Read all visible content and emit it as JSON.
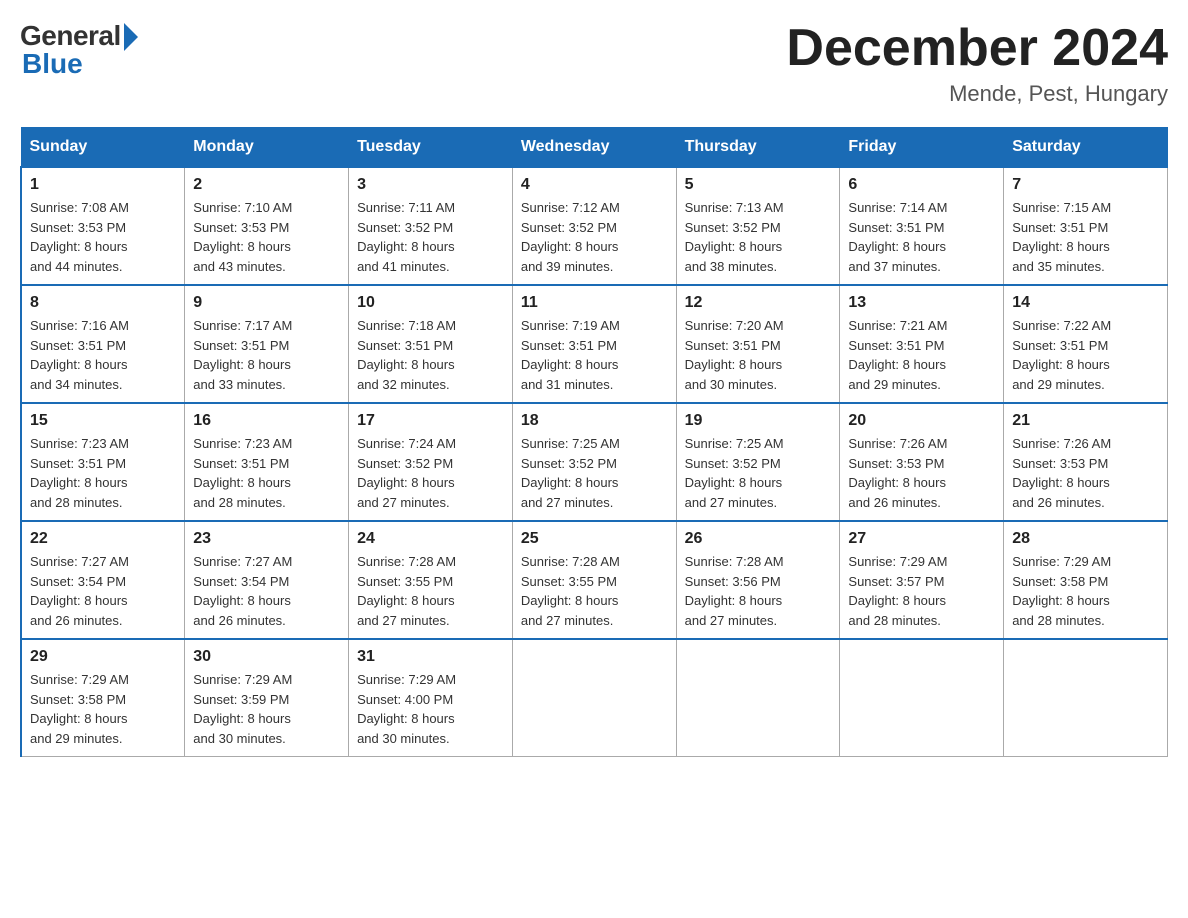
{
  "header": {
    "logo_general": "General",
    "logo_blue": "Blue",
    "month_year": "December 2024",
    "location": "Mende, Pest, Hungary"
  },
  "days_of_week": [
    "Sunday",
    "Monday",
    "Tuesday",
    "Wednesday",
    "Thursday",
    "Friday",
    "Saturday"
  ],
  "weeks": [
    [
      {
        "day": "1",
        "sunrise": "7:08 AM",
        "sunset": "3:53 PM",
        "daylight": "8 hours and 44 minutes."
      },
      {
        "day": "2",
        "sunrise": "7:10 AM",
        "sunset": "3:53 PM",
        "daylight": "8 hours and 43 minutes."
      },
      {
        "day": "3",
        "sunrise": "7:11 AM",
        "sunset": "3:52 PM",
        "daylight": "8 hours and 41 minutes."
      },
      {
        "day": "4",
        "sunrise": "7:12 AM",
        "sunset": "3:52 PM",
        "daylight": "8 hours and 39 minutes."
      },
      {
        "day": "5",
        "sunrise": "7:13 AM",
        "sunset": "3:52 PM",
        "daylight": "8 hours and 38 minutes."
      },
      {
        "day": "6",
        "sunrise": "7:14 AM",
        "sunset": "3:51 PM",
        "daylight": "8 hours and 37 minutes."
      },
      {
        "day": "7",
        "sunrise": "7:15 AM",
        "sunset": "3:51 PM",
        "daylight": "8 hours and 35 minutes."
      }
    ],
    [
      {
        "day": "8",
        "sunrise": "7:16 AM",
        "sunset": "3:51 PM",
        "daylight": "8 hours and 34 minutes."
      },
      {
        "day": "9",
        "sunrise": "7:17 AM",
        "sunset": "3:51 PM",
        "daylight": "8 hours and 33 minutes."
      },
      {
        "day": "10",
        "sunrise": "7:18 AM",
        "sunset": "3:51 PM",
        "daylight": "8 hours and 32 minutes."
      },
      {
        "day": "11",
        "sunrise": "7:19 AM",
        "sunset": "3:51 PM",
        "daylight": "8 hours and 31 minutes."
      },
      {
        "day": "12",
        "sunrise": "7:20 AM",
        "sunset": "3:51 PM",
        "daylight": "8 hours and 30 minutes."
      },
      {
        "day": "13",
        "sunrise": "7:21 AM",
        "sunset": "3:51 PM",
        "daylight": "8 hours and 29 minutes."
      },
      {
        "day": "14",
        "sunrise": "7:22 AM",
        "sunset": "3:51 PM",
        "daylight": "8 hours and 29 minutes."
      }
    ],
    [
      {
        "day": "15",
        "sunrise": "7:23 AM",
        "sunset": "3:51 PM",
        "daylight": "8 hours and 28 minutes."
      },
      {
        "day": "16",
        "sunrise": "7:23 AM",
        "sunset": "3:51 PM",
        "daylight": "8 hours and 28 minutes."
      },
      {
        "day": "17",
        "sunrise": "7:24 AM",
        "sunset": "3:52 PM",
        "daylight": "8 hours and 27 minutes."
      },
      {
        "day": "18",
        "sunrise": "7:25 AM",
        "sunset": "3:52 PM",
        "daylight": "8 hours and 27 minutes."
      },
      {
        "day": "19",
        "sunrise": "7:25 AM",
        "sunset": "3:52 PM",
        "daylight": "8 hours and 27 minutes."
      },
      {
        "day": "20",
        "sunrise": "7:26 AM",
        "sunset": "3:53 PM",
        "daylight": "8 hours and 26 minutes."
      },
      {
        "day": "21",
        "sunrise": "7:26 AM",
        "sunset": "3:53 PM",
        "daylight": "8 hours and 26 minutes."
      }
    ],
    [
      {
        "day": "22",
        "sunrise": "7:27 AM",
        "sunset": "3:54 PM",
        "daylight": "8 hours and 26 minutes."
      },
      {
        "day": "23",
        "sunrise": "7:27 AM",
        "sunset": "3:54 PM",
        "daylight": "8 hours and 26 minutes."
      },
      {
        "day": "24",
        "sunrise": "7:28 AM",
        "sunset": "3:55 PM",
        "daylight": "8 hours and 27 minutes."
      },
      {
        "day": "25",
        "sunrise": "7:28 AM",
        "sunset": "3:55 PM",
        "daylight": "8 hours and 27 minutes."
      },
      {
        "day": "26",
        "sunrise": "7:28 AM",
        "sunset": "3:56 PM",
        "daylight": "8 hours and 27 minutes."
      },
      {
        "day": "27",
        "sunrise": "7:29 AM",
        "sunset": "3:57 PM",
        "daylight": "8 hours and 28 minutes."
      },
      {
        "day": "28",
        "sunrise": "7:29 AM",
        "sunset": "3:58 PM",
        "daylight": "8 hours and 28 minutes."
      }
    ],
    [
      {
        "day": "29",
        "sunrise": "7:29 AM",
        "sunset": "3:58 PM",
        "daylight": "8 hours and 29 minutes."
      },
      {
        "day": "30",
        "sunrise": "7:29 AM",
        "sunset": "3:59 PM",
        "daylight": "8 hours and 30 minutes."
      },
      {
        "day": "31",
        "sunrise": "7:29 AM",
        "sunset": "4:00 PM",
        "daylight": "8 hours and 30 minutes."
      },
      null,
      null,
      null,
      null
    ]
  ],
  "labels": {
    "sunrise": "Sunrise:",
    "sunset": "Sunset:",
    "daylight": "Daylight:"
  }
}
